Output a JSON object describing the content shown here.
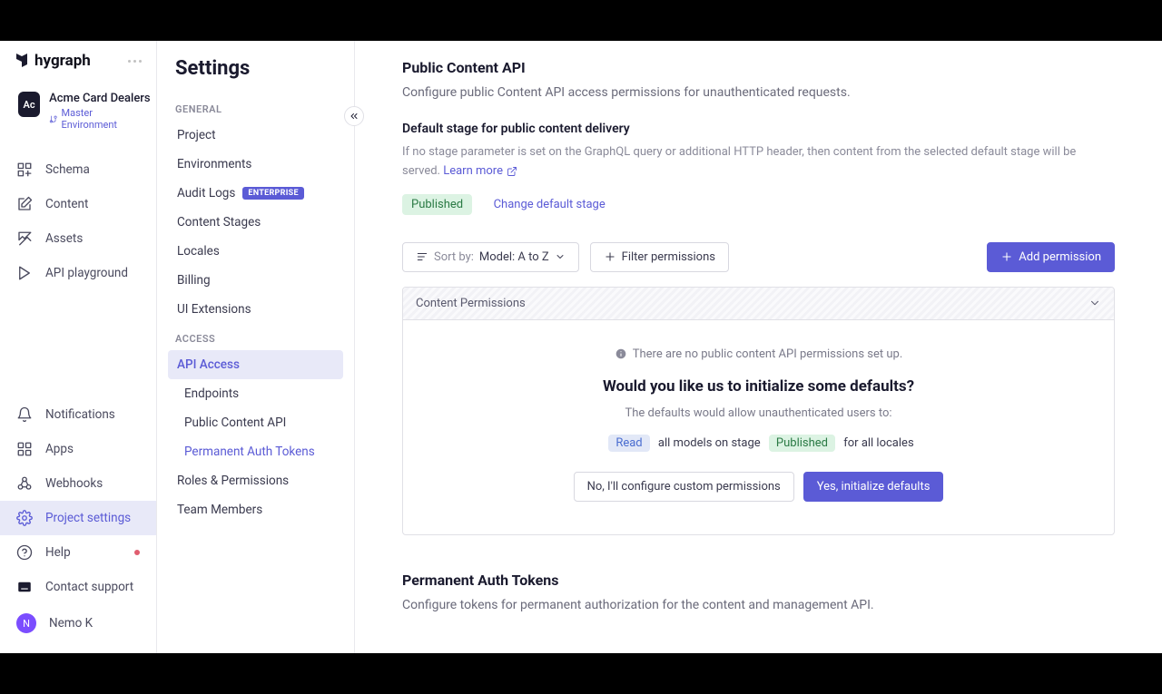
{
  "logo_text": "hygraph",
  "project": {
    "avatar": "Ac",
    "name": "Acme Card Dealers",
    "env_label": "Master Environment"
  },
  "nav1": {
    "schema": "Schema",
    "content": "Content",
    "assets": "Assets",
    "playground": "API playground",
    "notifications": "Notifications",
    "apps": "Apps",
    "webhooks": "Webhooks",
    "settings": "Project settings",
    "help": "Help",
    "support": "Contact support"
  },
  "user": {
    "avatar": "N",
    "name": "Nemo K"
  },
  "settings_title": "Settings",
  "sections": {
    "general": "GENERAL",
    "access": "ACCESS"
  },
  "nav2": {
    "project": "Project",
    "environments": "Environments",
    "audit": "Audit Logs",
    "enterprise_badge": "ENTERPRISE",
    "stages": "Content Stages",
    "locales": "Locales",
    "billing": "Billing",
    "ui_ext": "UI Extensions",
    "api_access": "API Access",
    "endpoints": "Endpoints",
    "public_api": "Public Content API",
    "pat": "Permanent Auth Tokens",
    "roles": "Roles & Permissions",
    "team": "Team Members"
  },
  "main": {
    "public_api": {
      "title": "Public Content API",
      "desc": "Configure public Content API access permissions for unauthenticated requests.",
      "stage_title": "Default stage for public content delivery",
      "stage_desc": "If no stage parameter is set on the GraphQL query or additional HTTP header, then content from the selected default stage will be served. ",
      "learn_more": "Learn more",
      "stage_value": "Published",
      "change_stage": "Change default stage",
      "sort_label": "Sort by: ",
      "sort_value": "Model: A to Z",
      "filter": "Filter permissions",
      "add": "Add permission",
      "panel_title": "Content Permissions",
      "empty_info": "There are no public content API permissions set up.",
      "empty_title": "Would you like us to initialize some defaults?",
      "empty_desc": "The defaults would allow unauthenticated users to:",
      "perm_read": "Read",
      "perm_mid": "all models on stage",
      "perm_stage": "Published",
      "perm_end": "for all locales",
      "btn_no": "No, I'll configure custom permissions",
      "btn_yes": "Yes, initialize defaults"
    },
    "pat": {
      "title": "Permanent Auth Tokens",
      "desc": "Configure tokens for permanent authorization for the content and management API."
    }
  }
}
